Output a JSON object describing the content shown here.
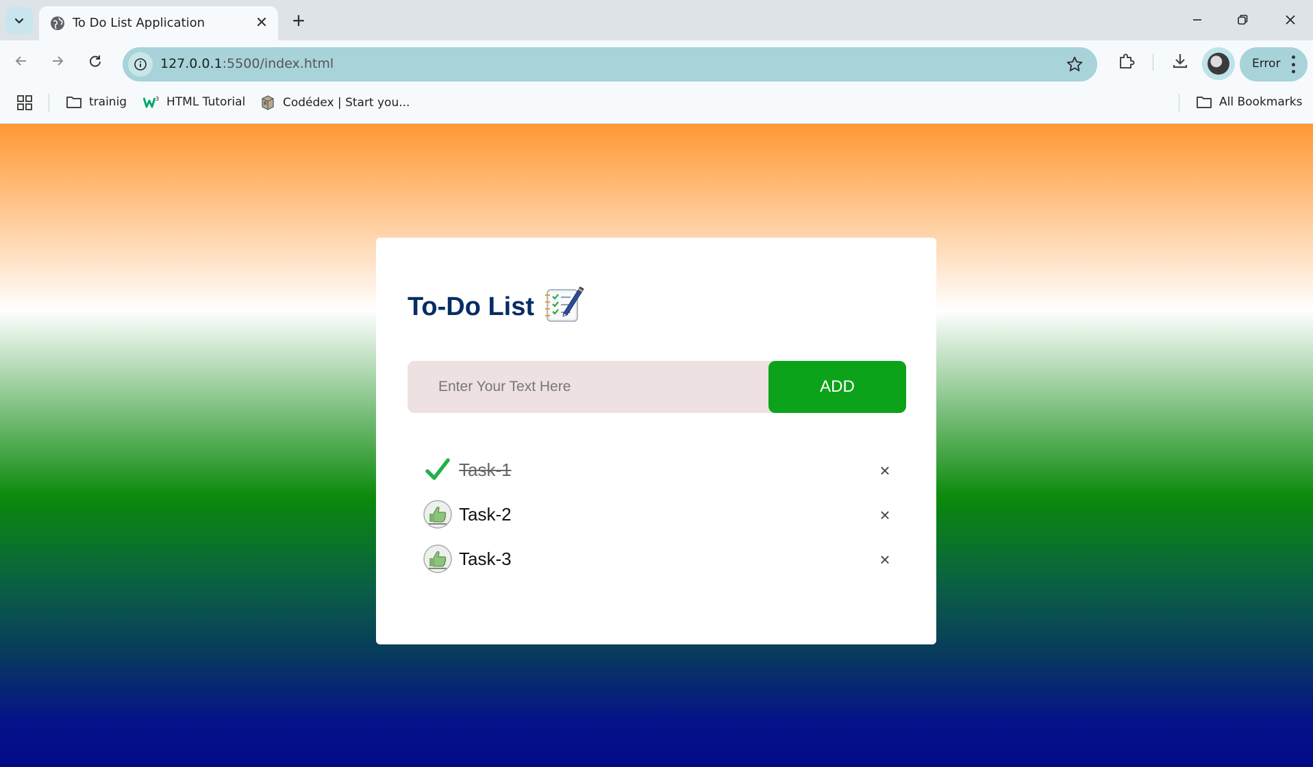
{
  "browser": {
    "tab_title": "To Do List Application",
    "url_host": "127.0.0.1",
    "url_path": ":5500/index.html",
    "profile_status": "Error",
    "bookmarks": [
      {
        "label": "trainig",
        "icon": "folder-icon"
      },
      {
        "label": "HTML Tutorial",
        "icon": "w3schools-icon"
      },
      {
        "label": "Codédex | Start you...",
        "icon": "codedex-icon"
      }
    ],
    "all_bookmarks_label": "All Bookmarks"
  },
  "app": {
    "title": "To-Do List",
    "title_icon": "notepad-checklist-icon",
    "input_placeholder": "Enter Your Text Here",
    "add_button_label": "ADD",
    "tasks": [
      {
        "text": "Task-1",
        "completed": true,
        "icon": "check-icon"
      },
      {
        "text": "Task-2",
        "completed": false,
        "icon": "thumbs-up-icon"
      },
      {
        "text": "Task-3",
        "completed": false,
        "icon": "thumbs-up-icon"
      }
    ],
    "remove_symbol": "×"
  },
  "colors": {
    "accent_green": "#0ca31a",
    "title_navy": "#062d64",
    "input_bg": "#ede1e1"
  }
}
